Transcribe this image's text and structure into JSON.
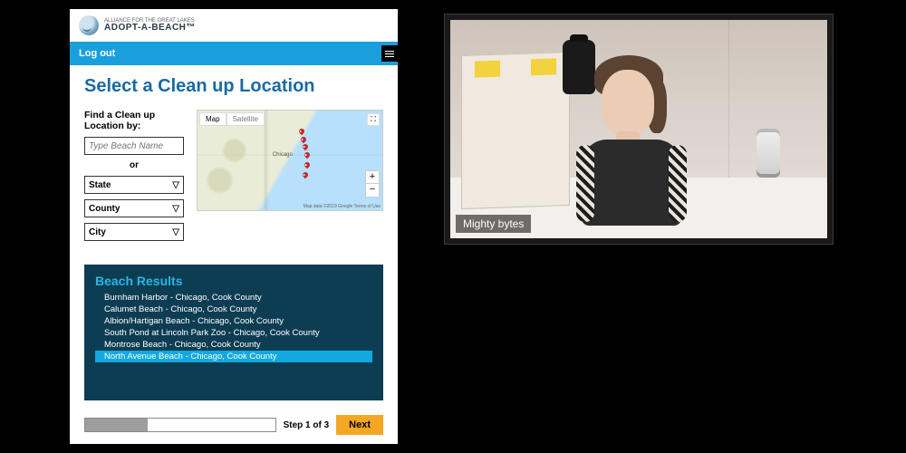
{
  "brand": {
    "small": "ALLIANCE FOR THE GREAT LAKES",
    "name": "ADOPT-A-BEACH™"
  },
  "topbar": {
    "logout": "Log out"
  },
  "page": {
    "title": "Select a Clean up Location",
    "find_label": "Find a Clean up Location by:",
    "beach_placeholder": "Type Beach Name",
    "or": "or",
    "selects": {
      "state": "State",
      "county": "County",
      "city": "City"
    }
  },
  "map": {
    "tab_map": "Map",
    "tab_sat": "Satellite",
    "city": "Chicago",
    "attribution": "Map data ©2019 Google  Terms of Use",
    "zoom_in": "+",
    "zoom_out": "−",
    "fullscreen": "⛶"
  },
  "results": {
    "heading": "Beach Results",
    "items": [
      {
        "label": "Burnham Harbor - Chicago, Cook County",
        "selected": false
      },
      {
        "label": "Calumet Beach - Chicago, Cook County",
        "selected": false
      },
      {
        "label": "Albion/Hartigan Beach - Chicago, Cook County",
        "selected": false
      },
      {
        "label": "South Pond at Lincoln Park Zoo - Chicago, Cook County",
        "selected": false
      },
      {
        "label": "Montrose Beach - Chicago, Cook County",
        "selected": false
      },
      {
        "label": "North Avenue Beach - Chicago, Cook County",
        "selected": true
      }
    ]
  },
  "footer": {
    "step": "Step 1 of 3",
    "next": "Next",
    "progress_pct": 33
  },
  "video": {
    "participant_name": "Mighty bytes"
  }
}
